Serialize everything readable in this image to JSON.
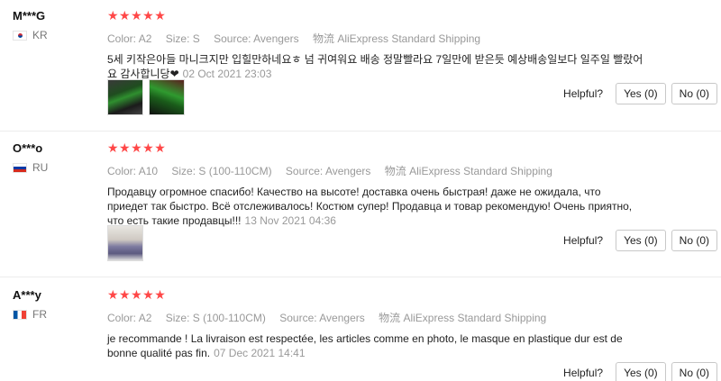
{
  "labels": {
    "color": "Color:",
    "size": "Size:",
    "source": "Source:",
    "shipping": "物流",
    "helpful": "Helpful?"
  },
  "reviews": [
    {
      "user": "M***G",
      "country": "KR",
      "stars": "★★★★★",
      "color": "A2",
      "size": "S",
      "source": "Avengers",
      "shipping": "AliExpress Standard Shipping",
      "text": "5세 키작은아들 마니크지만 입힐만하네요ㅎ 넘 귀여워요 배송 정말빨라요 7일만에 받은듯 예상배송일보다 일주일 빨랐어요 감사합니당❤",
      "date": "02 Oct 2021 23:03",
      "yes": "Yes (0)",
      "no": "No (0)",
      "photos": [
        "green-mask-photo",
        "green-mask-photo"
      ]
    },
    {
      "user": "O***o",
      "country": "RU",
      "stars": "★★★★★",
      "color": "A10",
      "size": "S (100-110CM)",
      "source": "Avengers",
      "shipping": "AliExpress Standard Shipping",
      "text": "Продавцу огромное спасибо! Качество на высоте! доставка очень быстрая! даже не ожидала, что приедет так быстро. Всё отслеживалось! Костюм супер! Продавца и товар рекомендую! Очень приятно, что есть такие продавцы!!!",
      "date": "13 Nov 2021 04:36",
      "yes": "Yes (0)",
      "no": "No (0)",
      "photos": [
        "child-costume-photo"
      ]
    },
    {
      "user": "A***y",
      "country": "FR",
      "stars": "★★★★★",
      "color": "A2",
      "size": "S (100-110CM)",
      "source": "Avengers",
      "shipping": "AliExpress Standard Shipping",
      "text": "je recommande ! La livraison est respectée, les articles comme en photo, le masque en plastique dur est de bonne qualité pas fin.",
      "date": "07 Dec 2021 14:41",
      "yes": "Yes (0)",
      "no": "No (0)",
      "photos": []
    }
  ]
}
